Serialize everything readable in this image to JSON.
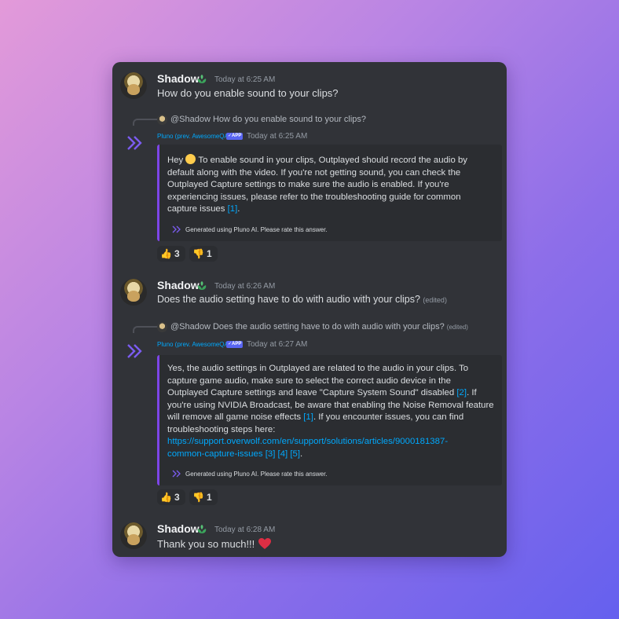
{
  "messages": [
    {
      "author": "Shadow",
      "time": "Today at 6:25 AM",
      "text": "How do you enable sound to your clips?"
    },
    {
      "author": "Shadow",
      "time": "Today at 6:26 AM",
      "text": "Does the audio setting have to do with audio with your clips?",
      "edited": "(edited)"
    },
    {
      "author": "Shadow",
      "time": "Today at 6:28 AM",
      "text": "Thank you so much!!!"
    }
  ],
  "replies": [
    {
      "reply_text": "@Shadow How do you enable sound to your clips?",
      "bot_name": "Pluno (prev. AwesomeQA)",
      "app_tag": "✓APP",
      "time": "Today at 6:25 AM",
      "embed_lines": [
        "To enable sound in your clips, Outplayed should record the audio by",
        "default along with the video. If you're not getting sound, you can check the",
        "Outplayed Capture settings to make sure the audio is enabled. If you're",
        "experiencing issues, please refer to the troubleshooting guide for common"
      ],
      "greeting": "Hey",
      "last_line": "capture issues",
      "cite1": "[1]",
      "footer": "Generated using Pluno AI. Please rate this answer.",
      "reactions": [
        {
          "emoji": "thumbs-up",
          "count": "3"
        },
        {
          "emoji": "thumbs-down",
          "count": "1"
        }
      ]
    },
    {
      "reply_text": "@Shadow Does the audio setting have to do with audio with your clips?",
      "reply_edited": "(edited)",
      "bot_name": "Pluno (prev. AwesomeQA)",
      "app_tag": "✓APP",
      "time": "Today at 6:27 AM",
      "line1": "Yes, the audio settings in Outplayed are related to the audio in your clips. To",
      "line2": "capture game audio, make sure to select the correct audio device in the",
      "line3": "Outplayed Capture settings and leave \"Capture System Sound\" disabled",
      "cite2": "[2]",
      "line3b": ". If",
      "line4": "you're using NVIDIA Broadcast, be aware that enabling the Noise Removal feature",
      "line5": "will remove all game noise effects",
      "cite1": "[1]",
      "line5b": ". If you encounter issues, you can find",
      "line6": "troubleshooting steps here:",
      "url1": "https://support.overwolf.com/en/support/solutions/articles/9000181387-",
      "url2": "common-capture-issues",
      "cites": "[3] [4] [5]",
      "footer": "Generated using Pluno AI. Please rate this answer.",
      "reactions": [
        {
          "emoji": "thumbs-up",
          "count": "3"
        },
        {
          "emoji": "thumbs-down",
          "count": "1"
        }
      ]
    }
  ],
  "colors": {
    "accent": "#7d45e8",
    "link": "#00a8fc",
    "background": "#313338"
  }
}
